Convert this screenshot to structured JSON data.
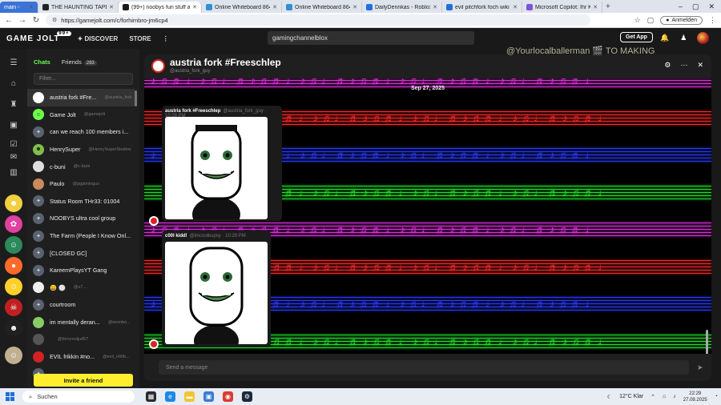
{
  "browser": {
    "tabs": [
      {
        "label": "main -",
        "color": "#3c74d6"
      },
      {
        "label": "THE HAUNTING TAPES C",
        "color": "#222222"
      },
      {
        "label": "(99+) noobys fun stuff and thi",
        "color": "#191919"
      },
      {
        "label": "Online Whiteboard 86471518",
        "color": "#2f8fd8"
      },
      {
        "label": "Online Whiteboard 86458342",
        "color": "#2f8fd8"
      },
      {
        "label": "DailyDennkas - Roblox",
        "color": "#1f6fe0"
      },
      {
        "label": "evil pitchfork foch wiki - Suche",
        "color": "#1e6fd9"
      },
      {
        "label": "Microsoft Copilot: Ihr KI-Begle",
        "color": "#7a55d8"
      }
    ],
    "url": "https://gamejolt.com/c/forhimbro-jm6cp4",
    "signin_label": "Anmelden"
  },
  "gamejolt": {
    "logo": "GAME JOLT",
    "logo_badge": "99+",
    "nav": [
      "DISCOVER",
      "STORE"
    ],
    "search_value": "gamingchannelblox",
    "get_app_label": "Get App"
  },
  "overlay_text": "@Yourlocalballerman 🎬 TO MAKING",
  "sidebar": {
    "tab_chats": "Chats",
    "tab_friends": "Friends",
    "friends_count": "283",
    "filter_placeholder": "Filter...",
    "items": [
      {
        "name": "austria fork #Fre...",
        "sub": "@austria_fork",
        "avatar": "#ffffff",
        "glyph": "",
        "group": false
      },
      {
        "name": "Game Jolt",
        "sub": "@gamejolt",
        "avatar": "#6cff4a",
        "glyph": "☺",
        "group": false
      },
      {
        "name": "can we reach 100 members i...",
        "sub": "",
        "avatar": "#5a6270",
        "glyph": "✦",
        "group": true
      },
      {
        "name": "HenrySuper",
        "sub": "@HenrySuperStudios",
        "avatar": "#7fbf4a",
        "glyph": "☻",
        "group": false
      },
      {
        "name": "c-buni",
        "sub": "@c-buni",
        "avatar": "#dddddd",
        "glyph": "",
        "group": false
      },
      {
        "name": "Paulo",
        "sub": "@pgpimingus",
        "avatar": "#c98a5c",
        "glyph": "",
        "group": false
      },
      {
        "name": "Status Room THr33: 01004",
        "sub": "",
        "avatar": "#5a6270",
        "glyph": "✦",
        "group": true
      },
      {
        "name": "NOOBYS ultra cool group",
        "sub": "",
        "avatar": "#5a6270",
        "glyph": "✦",
        "group": true
      },
      {
        "name": "The Farm (People I Know Onl...",
        "sub": "",
        "avatar": "#5a6270",
        "glyph": "✦",
        "group": true
      },
      {
        "name": "[CLOSED GC]",
        "sub": "",
        "avatar": "#5a6270",
        "glyph": "✦",
        "group": true
      },
      {
        "name": "KareemPlaysYT Gang",
        "sub": "",
        "avatar": "#5a6270",
        "glyph": "✦",
        "group": true
      },
      {
        "name": "😀 ⚪",
        "sub": "@x7...",
        "avatar": "#eeeeee",
        "glyph": "",
        "group": false
      },
      {
        "name": "courtroom",
        "sub": "",
        "avatar": "#5a6270",
        "glyph": "✦",
        "group": true
      },
      {
        "name": "im mentally deran...",
        "sub": "@wombo...",
        "avatar": "#88cc66",
        "glyph": "",
        "group": false
      },
      {
        "name": "",
        "sub": "@forscooljud57",
        "avatar": "#555555",
        "glyph": "",
        "group": false
      },
      {
        "name": "EVIL frikkin #no...",
        "sub": "@evil_n00b...",
        "avatar": "#d22222",
        "glyph": "",
        "group": false
      },
      {
        "name": "",
        "sub": "",
        "avatar": "#5a6270",
        "glyph": "✦",
        "group": true
      }
    ],
    "invite_label": "Invite a friend"
  },
  "chat": {
    "title": "austria fork #Freeschlep",
    "username": "@austria_fork_guy",
    "date": "Sep 27, 2025",
    "messages": [
      {
        "author": "austria fork #Freeschlep",
        "meta": "@austria_fork_guy · 10:28 PM"
      },
      {
        "author": "c00l kidd!",
        "meta": "@imcoolkupsy · 10:29 PM"
      }
    ],
    "composer_placeholder": "Send a message"
  },
  "taskbar": {
    "search_label": "Suchen",
    "weather": "12°C  Klar",
    "time": "22:29",
    "date": "27.09.2025"
  },
  "colors": {
    "gj_green": "#6cff4a",
    "invite_yellow": "#ffee2e",
    "staff_red": "#ff2a2a",
    "staff_blue": "#2a3bff",
    "staff_green": "#22e02a",
    "staff_magenta": "#e030e0"
  }
}
